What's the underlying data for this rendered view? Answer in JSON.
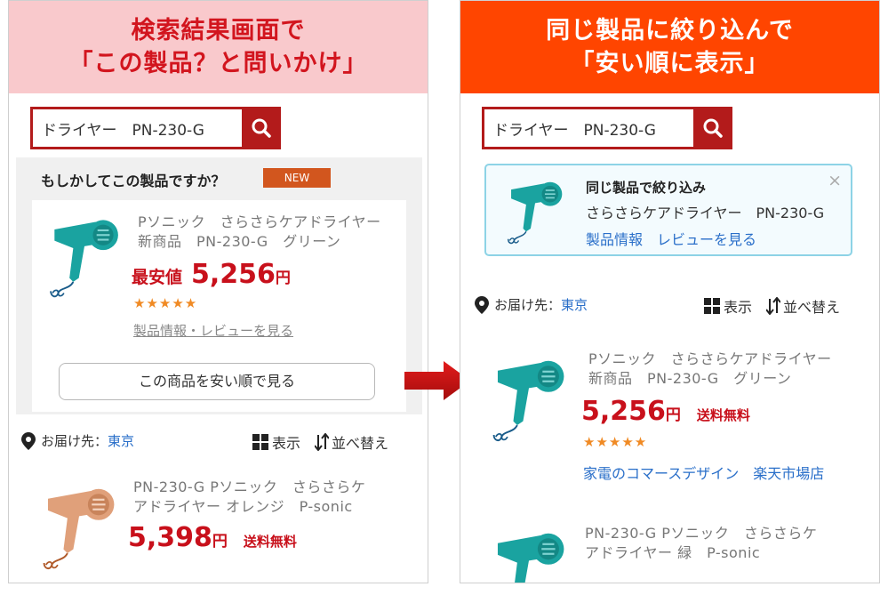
{
  "left": {
    "banner_line1": "検索結果画面で",
    "banner_line2": "「この製品？と問いかけ」",
    "search_query": "ドライヤー　PN-230-G",
    "suggest_title": "もしかしてこの製品ですか？",
    "new_badge": "NEW",
    "product1": {
      "name_line1": "Pソニック　さらさらケアドライヤー",
      "name_line2": "新商品　PN-230-G　グリーン",
      "lowest_label": "最安値",
      "price": "5,256",
      "yen": "円",
      "stars": "★★★★★",
      "info_link": "製品情報・レビューを見る",
      "view_cheapest_button": "この商品を安い順で見る"
    },
    "deliver_label": "お届け先：",
    "deliver_city": "東京",
    "view_label": "表示",
    "sort_label": "並べ替え",
    "product2": {
      "name_line1": "PN-230-G  Pソニック　さらさらケ",
      "name_line2": "アドライヤー オレンジ　P-sonic",
      "price": "5,398",
      "yen": "円",
      "free_shipping": "送料無料"
    }
  },
  "right": {
    "banner_line1": "同じ製品に絞り込んで",
    "banner_line2": "「安い順に表示」",
    "search_query": "ドライヤー　PN-230-G",
    "filter": {
      "title": "同じ製品で絞り込み",
      "product": "さらさらケアドライヤー　PN-230-G",
      "info_link": "製品情報",
      "review_link": "レビューを見る",
      "close": "×"
    },
    "deliver_label": "お届け先：",
    "deliver_city": "東京",
    "view_label": "表示",
    "sort_label": "並べ替え",
    "product1": {
      "name_line1": "Pソニック　さらさらケアドライヤー",
      "name_line2": "新商品　PN-230-G　グリーン",
      "price": "5,256",
      "yen": "円",
      "free_shipping": "送料無料",
      "stars": "★★★★★",
      "shop": "家電のコマースデザイン　楽天市場店"
    },
    "product2": {
      "name_line1": "PN-230-G  Pソニック　さらさらケ",
      "name_line2": "アドライヤー 緑　P-sonic"
    }
  },
  "colors": {
    "accent_red": "#c8101b",
    "banner_pink": "#f9c9cc",
    "banner_orange": "#ff4500",
    "link_blue": "#2a6fc9",
    "dryer_teal": "#1aa3a0",
    "dryer_orange": "#e0a07a"
  },
  "icons": [
    "search-icon",
    "location-pin-icon",
    "grid-view-icon",
    "sort-icon",
    "close-icon",
    "arrow-right-icon",
    "hair-dryer-icon"
  ]
}
